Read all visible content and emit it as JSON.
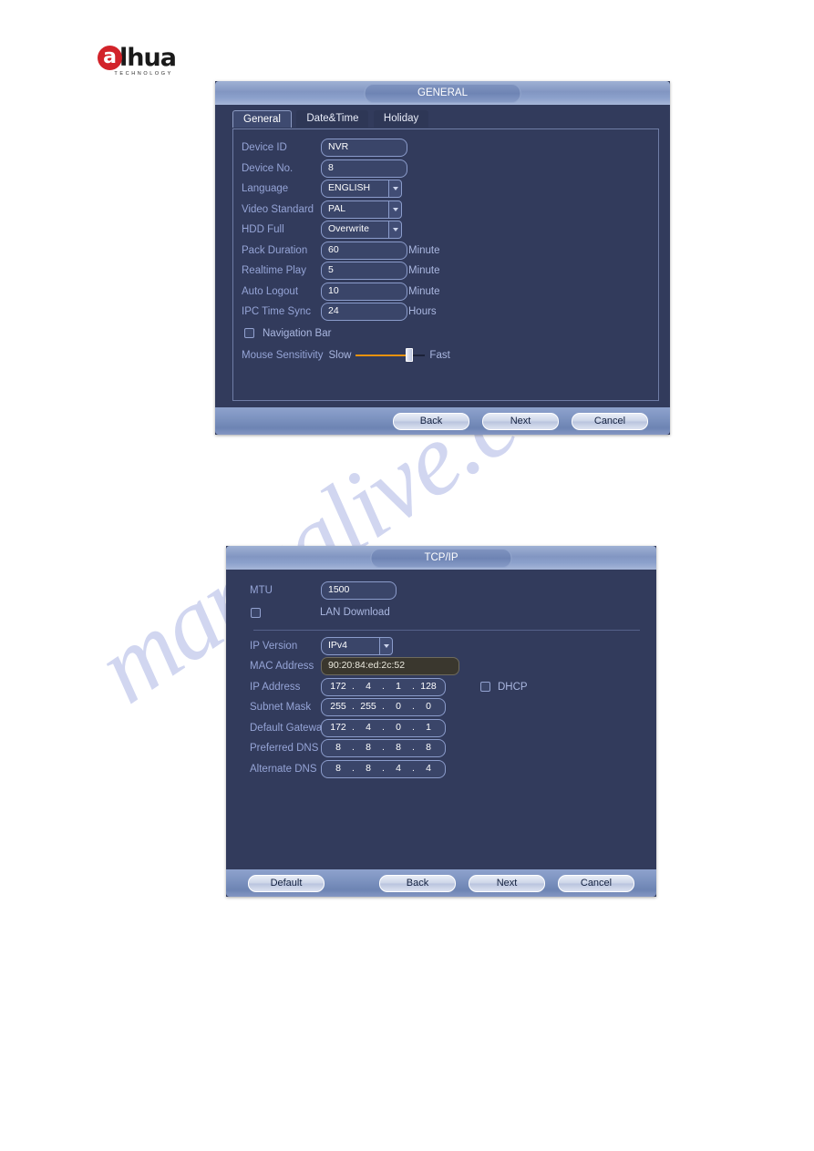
{
  "brand": {
    "logo_mark": "a",
    "logo_word": "lhua",
    "logo_sub": "TECHNOLOGY"
  },
  "watermark": {
    "text": "manualive.com"
  },
  "general_dialog": {
    "title": "GENERAL",
    "tabs": [
      {
        "label": "General",
        "active": true
      },
      {
        "label": "Date&Time",
        "active": false
      },
      {
        "label": "Holiday",
        "active": false
      }
    ],
    "fields": {
      "device_id": {
        "label": "Device ID",
        "value": "NVR"
      },
      "device_no": {
        "label": "Device No.",
        "value": "8"
      },
      "language": {
        "label": "Language",
        "value": "ENGLISH"
      },
      "video_standard": {
        "label": "Video Standard",
        "value": "PAL"
      },
      "hdd_full": {
        "label": "HDD Full",
        "value": "Overwrite"
      },
      "pack_duration": {
        "label": "Pack Duration",
        "value": "60",
        "unit": "Minute"
      },
      "realtime_play": {
        "label": "Realtime Play",
        "value": "5",
        "unit": "Minute"
      },
      "auto_logout": {
        "label": "Auto Logout",
        "value": "10",
        "unit": "Minute"
      },
      "ipc_time_sync": {
        "label": "IPC Time Sync",
        "value": "24",
        "unit": "Hours"
      },
      "navigation_bar": {
        "label": "Navigation Bar",
        "checked": false
      },
      "mouse_sensitivity": {
        "label": "Mouse Sensitivity",
        "min_label": "Slow",
        "max_label": "Fast",
        "position_percent": 80
      }
    },
    "buttons": {
      "back": "Back",
      "next": "Next",
      "cancel": "Cancel"
    }
  },
  "tcpip_dialog": {
    "title": "TCP/IP",
    "fields": {
      "mtu": {
        "label": "MTU",
        "value": "1500"
      },
      "lan_download": {
        "label": "LAN Download",
        "checked": false
      },
      "ip_version": {
        "label": "IP Version",
        "value": "IPv4"
      },
      "mac_address": {
        "label": "MAC Address",
        "value": "90:20:84:ed:2c:52"
      },
      "ip_address": {
        "label": "IP Address",
        "octets": [
          "172",
          "4",
          "1",
          "128"
        ]
      },
      "subnet_mask": {
        "label": "Subnet Mask",
        "octets": [
          "255",
          "255",
          "0",
          "0"
        ]
      },
      "default_gateway": {
        "label": "Default Gateway",
        "octets": [
          "172",
          "4",
          "0",
          "1"
        ]
      },
      "preferred_dns": {
        "label": "Preferred DNS",
        "octets": [
          "8",
          "8",
          "8",
          "8"
        ]
      },
      "alternate_dns": {
        "label": "Alternate DNS",
        "octets": [
          "8",
          "8",
          "4",
          "4"
        ]
      },
      "dhcp": {
        "label": "DHCP",
        "checked": false
      }
    },
    "buttons": {
      "default": "Default",
      "back": "Back",
      "next": "Next",
      "cancel": "Cancel"
    }
  },
  "colors": {
    "dialog_bg": "#323b5c",
    "titlebar": "#8296c2",
    "label_text": "#95a4d6",
    "accent_orange": "#e8920f",
    "brand_red": "#d2232a"
  }
}
